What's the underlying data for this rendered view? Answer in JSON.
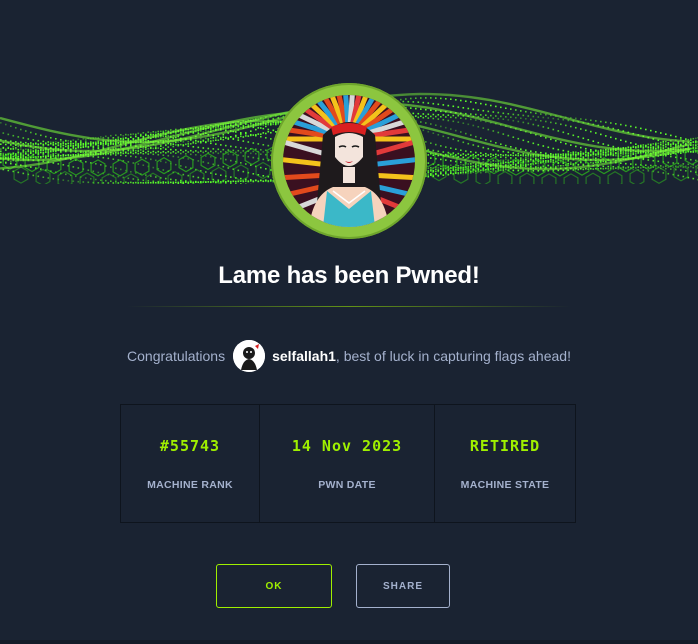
{
  "modal": {
    "title": "Lame has been Pwned!"
  },
  "congrats": {
    "prefix": "Congratulations",
    "username": "selfallah1",
    "suffix": ", best of luck in capturing flags ahead!"
  },
  "stats": [
    {
      "value": "#55743",
      "label": "MACHINE RANK"
    },
    {
      "value": "14 Nov 2023",
      "label": "PWN DATE"
    },
    {
      "value": "RETIRED",
      "label": "MACHINE STATE"
    }
  ],
  "buttons": {
    "ok_label": "OK",
    "share_label": "SHARE"
  },
  "colors": {
    "background": "#1a2332",
    "accent": "#9fef00",
    "muted_text": "#a4b1cd",
    "ring": "#8cc63f"
  },
  "icons": {
    "banner": "green-hexagon-wave",
    "machine_avatar": "lame-machine-avatar",
    "user_avatar": "user-avatar"
  }
}
